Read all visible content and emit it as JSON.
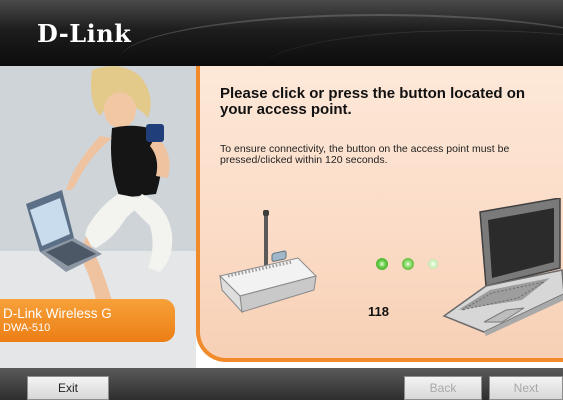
{
  "header": {
    "logo_text": "D-Link"
  },
  "product": {
    "name": "D-Link Wireless G",
    "model": "DWA-510"
  },
  "main": {
    "heading": "Please click or press the button located on your access point.",
    "instructions": "To ensure connectivity, the button on the access point must be pressed/clicked within 120 seconds.",
    "countdown": "118",
    "progress_dots": 3,
    "active_dots": 2
  },
  "footer": {
    "exit_label": "Exit",
    "back_label": "Back",
    "next_label": "Next",
    "back_enabled": false,
    "next_enabled": false
  },
  "colors": {
    "accent": "#f08a2a",
    "content_bg": "#fbdcc7",
    "dot_active": "#66cc44"
  },
  "icons": [
    "router-icon",
    "laptop-icon",
    "signal-dot-icon"
  ]
}
